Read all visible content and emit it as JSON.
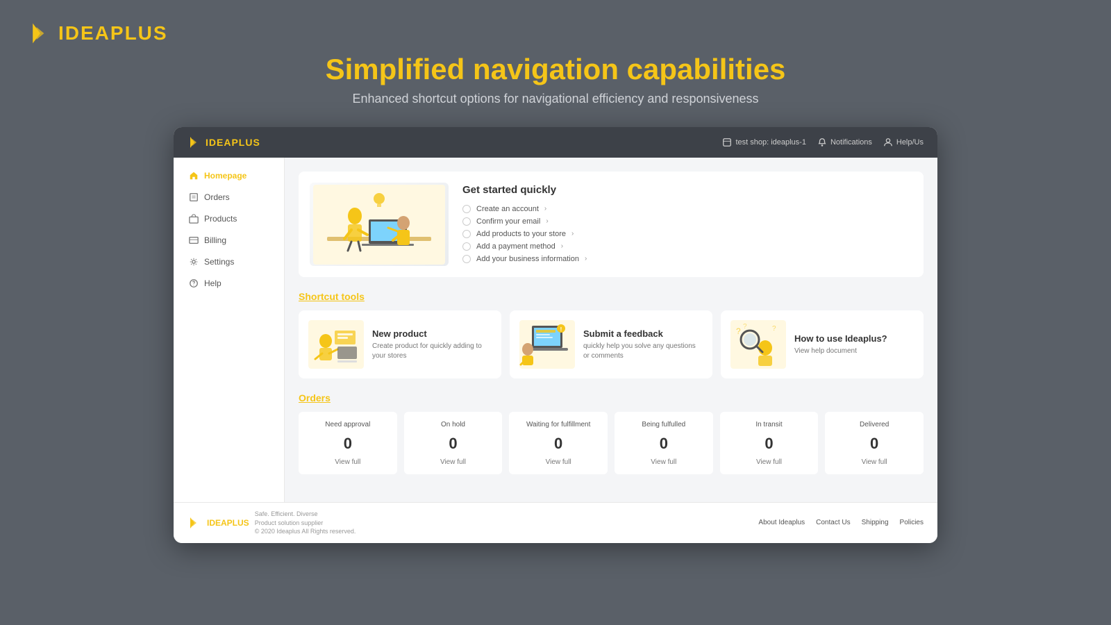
{
  "outer": {
    "logo_text": "IDEAPLUS",
    "title": "Simplified navigation capabilities",
    "subtitle": "Enhanced shortcut options for navigational efficiency and responsiveness"
  },
  "app_header": {
    "logo_text": "IDEAPLUS",
    "store_item": "test shop: ideaplus-1",
    "notifications_item": "Notifications",
    "help_item": "Help/Us"
  },
  "sidebar": {
    "items": [
      {
        "label": "Homepage",
        "icon": "home"
      },
      {
        "label": "Orders",
        "icon": "orders"
      },
      {
        "label": "Products",
        "icon": "products"
      },
      {
        "label": "Billing",
        "icon": "billing"
      },
      {
        "label": "Settings",
        "icon": "settings"
      },
      {
        "label": "Help",
        "icon": "help"
      }
    ]
  },
  "get_started": {
    "title": "Get started quickly",
    "checklist": [
      "Create an account",
      "Confirm your email",
      "Add products to your store",
      "Add a payment method",
      "Add your business information"
    ]
  },
  "shortcut_tools": {
    "section_title": "Shortcut tools",
    "cards": [
      {
        "title": "New product",
        "desc": "Create product for quickly adding to your stores"
      },
      {
        "title": "Submit a feedback",
        "desc": "quickly help you solve any questions or comments"
      },
      {
        "title": "How to use Ideaplus?",
        "desc": "View help document"
      }
    ]
  },
  "orders": {
    "section_title": "Orders",
    "cards": [
      {
        "label": "Need approval",
        "count": "0",
        "view": "View full"
      },
      {
        "label": "On hold",
        "count": "0",
        "view": "View full"
      },
      {
        "label": "Waiting for fulfillment",
        "count": "0",
        "view": "View full"
      },
      {
        "label": "Being fulfulled",
        "count": "0",
        "view": "View full"
      },
      {
        "label": "In transit",
        "count": "0",
        "view": "View full"
      },
      {
        "label": "Delivered",
        "count": "0",
        "view": "View full"
      }
    ]
  },
  "footer": {
    "logo_text": "IDEAPLUS",
    "tagline_line1": "Safe. Efficient. Diverse",
    "tagline_line2": "Product solution supplier",
    "tagline_line3": "© 2020 Ideaplus All Rights reserved.",
    "links": [
      "About Ideaplus",
      "Contact Us",
      "Shipping",
      "Policies"
    ]
  }
}
